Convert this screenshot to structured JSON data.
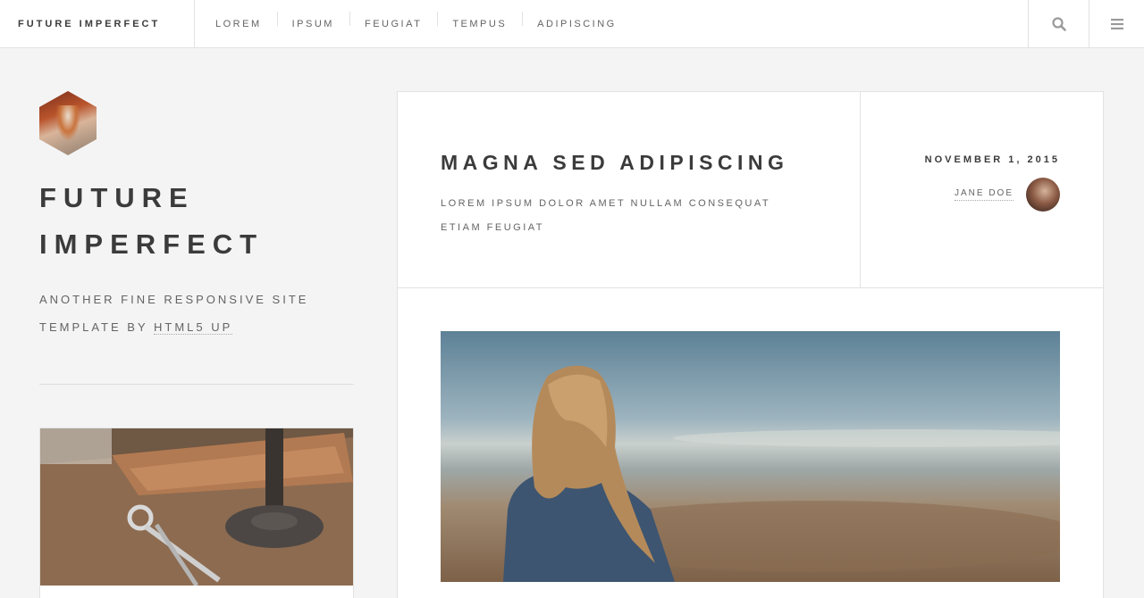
{
  "header": {
    "brand": "FUTURE IMPERFECT",
    "nav": [
      {
        "label": "LOREM"
      },
      {
        "label": "IPSUM"
      },
      {
        "label": "FEUGIAT"
      },
      {
        "label": "TEMPUS"
      },
      {
        "label": "ADIPISCING"
      }
    ],
    "search_icon": "search-icon",
    "menu_icon": "menu-icon"
  },
  "intro": {
    "title_line1": "FUTURE",
    "title_line2": "IMPERFECT",
    "subtitle_line1": "ANOTHER FINE RESPONSIVE SITE",
    "subtitle_prefix": "TEMPLATE BY ",
    "subtitle_link": "HTML5 UP"
  },
  "post": {
    "title": "MAGNA SED ADIPISCING",
    "subtitle": "LOREM IPSUM DOLOR AMET NULLAM CONSEQUAT ETIAM FEUGIAT",
    "date": "NOVEMBER 1, 2015",
    "author": "JANE DOE"
  },
  "colors": {
    "background": "#f4f4f4",
    "panel": "#ffffff",
    "border": "#e2e2e2",
    "text": "#3c3b3b",
    "muted": "#646464"
  }
}
